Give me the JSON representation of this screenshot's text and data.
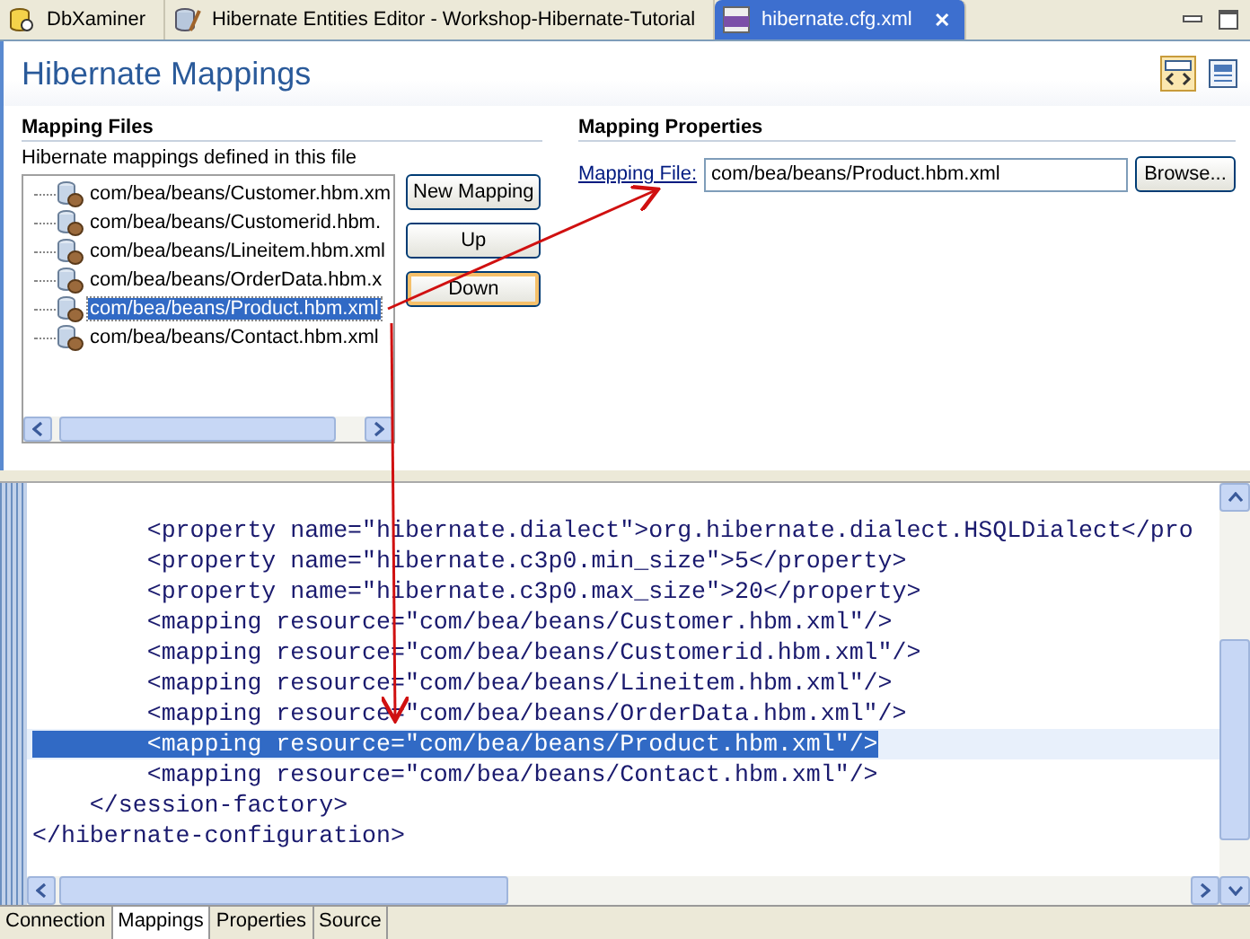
{
  "editor_tabs": [
    {
      "label": "DbXaminer",
      "kind": "database",
      "selected": false,
      "closable": false
    },
    {
      "label": "Hibernate Entities Editor - Workshop-Hibernate-Tutorial",
      "kind": "entities",
      "selected": false,
      "closable": false
    },
    {
      "label": "hibernate.cfg.xml",
      "kind": "xml",
      "selected": true,
      "closable": true
    }
  ],
  "close_glyph": "✕",
  "page_title": "Hibernate Mappings",
  "mapping_files": {
    "heading": "Mapping Files",
    "description": "Hibernate mappings defined in this file",
    "items": [
      {
        "label": "com/bea/beans/Customer.hbm.xm",
        "selected": false
      },
      {
        "label": "com/bea/beans/Customerid.hbm.",
        "selected": false
      },
      {
        "label": "com/bea/beans/Lineitem.hbm.xml",
        "selected": false
      },
      {
        "label": "com/bea/beans/OrderData.hbm.x",
        "selected": false
      },
      {
        "label": "com/bea/beans/Product.hbm.xml",
        "selected": true
      },
      {
        "label": "com/bea/beans/Contact.hbm.xml",
        "selected": false
      }
    ],
    "buttons": [
      {
        "label": "New Mapping",
        "focused": false
      },
      {
        "label": "Up",
        "focused": false
      },
      {
        "label": "Down",
        "focused": true
      }
    ]
  },
  "mapping_properties": {
    "heading": "Mapping Properties",
    "field_label": "Mapping File:",
    "field_value": "com/bea/beans/Product.hbm.xml",
    "browse_button": "Browse..."
  },
  "source_lines": [
    {
      "text": "        <property name=\"hibernate.dialect\">org.hibernate.dialect.HSQLDialect</pro",
      "selected": false
    },
    {
      "text": "        <property name=\"hibernate.c3p0.min_size\">5</property>",
      "selected": false
    },
    {
      "text": "        <property name=\"hibernate.c3p0.max_size\">20</property>",
      "selected": false
    },
    {
      "text": "        <mapping resource=\"com/bea/beans/Customer.hbm.xml\"/>",
      "selected": false
    },
    {
      "text": "        <mapping resource=\"com/bea/beans/Customerid.hbm.xml\"/>",
      "selected": false
    },
    {
      "text": "        <mapping resource=\"com/bea/beans/Lineitem.hbm.xml\"/>",
      "selected": false
    },
    {
      "text": "        <mapping resource=\"com/bea/beans/OrderData.hbm.xml\"/>",
      "selected": false
    },
    {
      "text": "        <mapping resource=\"com/bea/beans/Product.hbm.xml\"/>",
      "selected": true
    },
    {
      "text": "        <mapping resource=\"com/bea/beans/Contact.hbm.xml\"/>",
      "selected": false
    },
    {
      "text": "    </session-factory>",
      "selected": false
    },
    {
      "text": "</hibernate-configuration>",
      "selected": false
    }
  ],
  "page_tabs": [
    {
      "label": "Connection",
      "selected": false
    },
    {
      "label": "Mappings",
      "selected": true
    },
    {
      "label": "Properties",
      "selected": false
    },
    {
      "label": "Source",
      "selected": false
    }
  ]
}
